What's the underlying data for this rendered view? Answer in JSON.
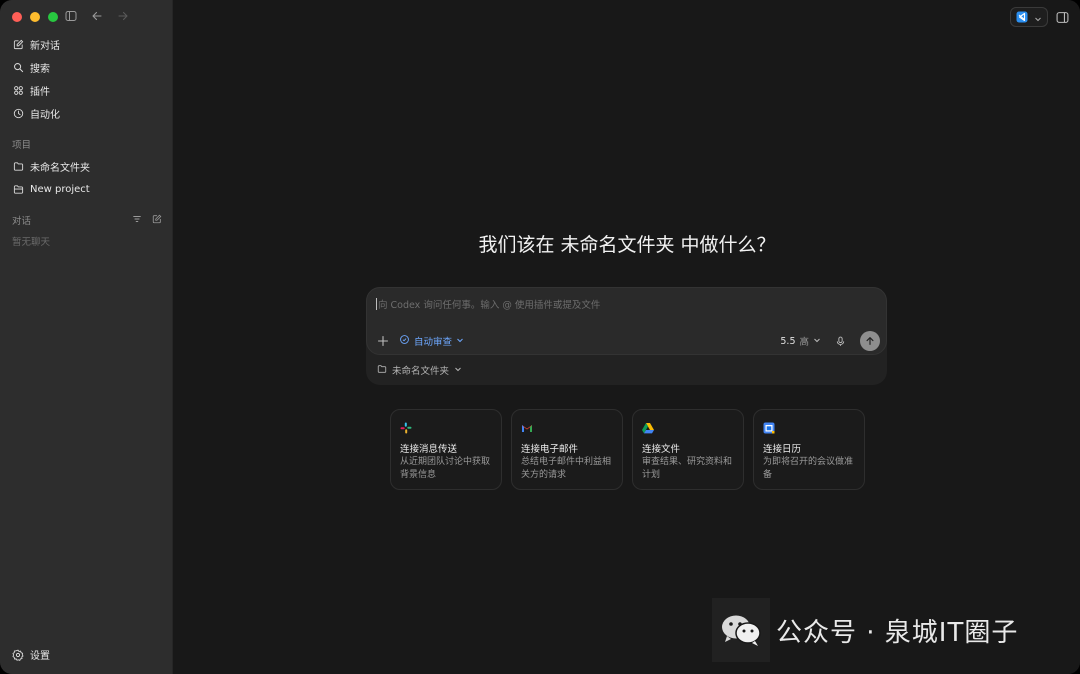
{
  "sidebar": {
    "nav": [
      {
        "label": "新对话",
        "icon": "compose-icon"
      },
      {
        "label": "搜索",
        "icon": "search-icon"
      },
      {
        "label": "插件",
        "icon": "plugins-icon"
      },
      {
        "label": "自动化",
        "icon": "clock-icon"
      }
    ],
    "projects_label": "项目",
    "projects": [
      {
        "label": "未命名文件夹",
        "icon": "folder-icon"
      },
      {
        "label": "New project",
        "icon": "folder-plus-icon"
      }
    ],
    "chats_label": "对话",
    "chats_empty": "暂无聊天",
    "settings_label": "设置"
  },
  "main": {
    "headline": "我们该在 未命名文件夹 中做什么？",
    "composer": {
      "placeholder": "向 Codex 询问任何事。输入 @ 使用插件或提及文件",
      "auto_review": "自动审查",
      "model": "5.5",
      "effort": "高",
      "folder": "未命名文件夹"
    },
    "cards": [
      {
        "title": "连接消息传送",
        "desc": "从近期团队讨论中获取背景信息",
        "icon": "slack-icon"
      },
      {
        "title": "连接电子邮件",
        "desc": "总结电子邮件中利益相关方的请求",
        "icon": "gmail-icon"
      },
      {
        "title": "连接文件",
        "desc": "审查结果、研究资料和计划",
        "icon": "google-drive-icon"
      },
      {
        "title": "连接日历",
        "desc": "为即将召开的会议做准备",
        "icon": "google-calendar-icon"
      }
    ]
  },
  "watermark": {
    "text": "公众号 · 泉城IT圈子"
  },
  "colors": {
    "accent_blue": "#6ea8ff",
    "sidebar_bg": "#2d2d2d",
    "main_bg": "#181818"
  }
}
